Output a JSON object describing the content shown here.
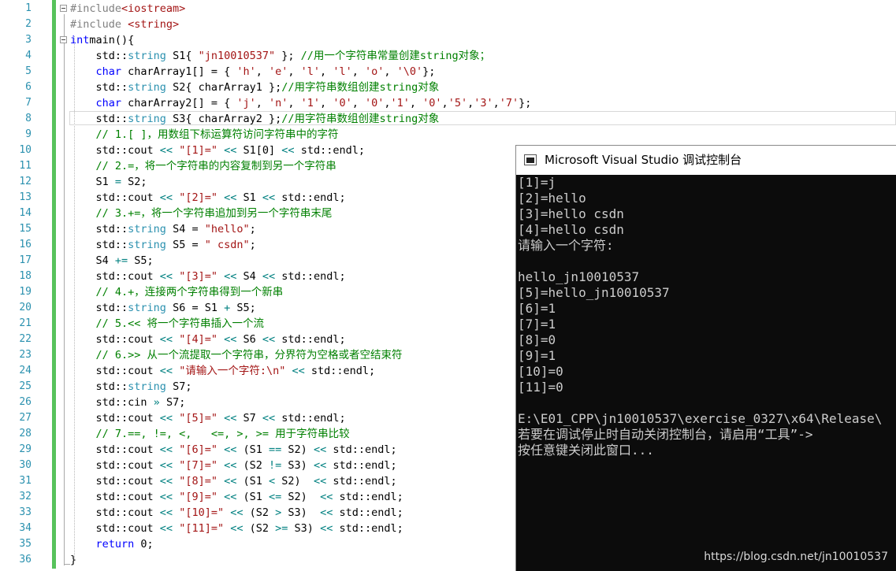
{
  "editor": {
    "line_numbers": [
      "1",
      "2",
      "3",
      "4",
      "5",
      "6",
      "7",
      "8",
      "9",
      "10",
      "11",
      "12",
      "13",
      "14",
      "15",
      "16",
      "17",
      "18",
      "19",
      "20",
      "21",
      "22",
      "23",
      "24",
      "25",
      "26",
      "27",
      "28",
      "29",
      "30",
      "31",
      "32",
      "33",
      "34",
      "35",
      "36"
    ],
    "lines": [
      [
        [
          "pp",
          "#include"
        ],
        [
          "inc",
          "<iostream>"
        ]
      ],
      [
        [
          "pp",
          "#include "
        ],
        [
          "inc",
          "<string>"
        ]
      ],
      [
        [
          "kw",
          "int"
        ],
        [
          "",
          "main(){"
        ]
      ],
      [
        [
          "",
          "    std::"
        ],
        [
          "ty",
          "string"
        ],
        [
          "",
          " S1{ "
        ],
        [
          "st",
          "\"jn10010537\""
        ],
        [
          "",
          " }; "
        ],
        [
          "cm",
          "//用一个字符串常量创建string对象；"
        ]
      ],
      [
        [
          "",
          "    "
        ],
        [
          "kw",
          "char"
        ],
        [
          "",
          " charArray1[] = { "
        ],
        [
          "st",
          "'h'"
        ],
        [
          "",
          ", "
        ],
        [
          "st",
          "'e'"
        ],
        [
          "",
          ", "
        ],
        [
          "st",
          "'l'"
        ],
        [
          "",
          ", "
        ],
        [
          "st",
          "'l'"
        ],
        [
          "",
          ", "
        ],
        [
          "st",
          "'o'"
        ],
        [
          "",
          ", "
        ],
        [
          "st",
          "'\\0'"
        ],
        [
          "",
          "};"
        ]
      ],
      [
        [
          "",
          "    std::"
        ],
        [
          "ty",
          "string"
        ],
        [
          "",
          " S2{ charArray1 };"
        ],
        [
          "cm",
          "//用字符串数组创建string对象"
        ]
      ],
      [
        [
          "",
          "    "
        ],
        [
          "kw",
          "char"
        ],
        [
          "",
          " charArray2[] = { "
        ],
        [
          "st",
          "'j'"
        ],
        [
          "",
          ", "
        ],
        [
          "st",
          "'n'"
        ],
        [
          "",
          ", "
        ],
        [
          "st",
          "'1'"
        ],
        [
          "",
          ", "
        ],
        [
          "st",
          "'0'"
        ],
        [
          "",
          ", "
        ],
        [
          "st",
          "'0'"
        ],
        [
          "",
          ","
        ],
        [
          "st",
          "'1'"
        ],
        [
          "",
          ", "
        ],
        [
          "st",
          "'0'"
        ],
        [
          "",
          ","
        ],
        [
          "st",
          "'5'"
        ],
        [
          "",
          ","
        ],
        [
          "st",
          "'3'"
        ],
        [
          "",
          ","
        ],
        [
          "st",
          "'7'"
        ],
        [
          "",
          "};"
        ]
      ],
      [
        [
          "",
          "    std::"
        ],
        [
          "ty",
          "string"
        ],
        [
          "",
          " S3{ charArray2 };"
        ],
        [
          "cm",
          "//用字符串数组创建string对象"
        ]
      ],
      [
        [
          "",
          "    "
        ],
        [
          "cm",
          "// 1.[ ]，用数组下标运算符访问字符串中的字符"
        ]
      ],
      [
        [
          "",
          "    std::cout "
        ],
        [
          "op",
          "<<"
        ],
        [
          "",
          " "
        ],
        [
          "st",
          "\"[1]=\""
        ],
        [
          "",
          " "
        ],
        [
          "op",
          "<<"
        ],
        [
          "",
          " S1[0] "
        ],
        [
          "op",
          "<<"
        ],
        [
          "",
          " std::endl;"
        ]
      ],
      [
        [
          "",
          "    "
        ],
        [
          "cm",
          "// 2.=，将一个字符串的内容复制到另一个字符串"
        ]
      ],
      [
        [
          "",
          "    S1 "
        ],
        [
          "op",
          "="
        ],
        [
          "",
          " S2;"
        ]
      ],
      [
        [
          "",
          "    std::cout "
        ],
        [
          "op",
          "<<"
        ],
        [
          "",
          " "
        ],
        [
          "st",
          "\"[2]=\""
        ],
        [
          "",
          " "
        ],
        [
          "op",
          "<<"
        ],
        [
          "",
          " S1 "
        ],
        [
          "op",
          "<<"
        ],
        [
          "",
          " std::endl;"
        ]
      ],
      [
        [
          "",
          "    "
        ],
        [
          "cm",
          "// 3.+=，将一个字符串追加到另一个字符串末尾"
        ]
      ],
      [
        [
          "",
          "    std::"
        ],
        [
          "ty",
          "string"
        ],
        [
          "",
          " S4 = "
        ],
        [
          "st",
          "\"hello\""
        ],
        [
          "",
          ";"
        ]
      ],
      [
        [
          "",
          "    std::"
        ],
        [
          "ty",
          "string"
        ],
        [
          "",
          " S5 = "
        ],
        [
          "st",
          "\" csdn\""
        ],
        [
          "",
          ";"
        ]
      ],
      [
        [
          "",
          "    S4 "
        ],
        [
          "op",
          "+="
        ],
        [
          "",
          " S5;"
        ]
      ],
      [
        [
          "",
          "    std::cout "
        ],
        [
          "op",
          "<<"
        ],
        [
          "",
          " "
        ],
        [
          "st",
          "\"[3]=\""
        ],
        [
          "",
          " "
        ],
        [
          "op",
          "<<"
        ],
        [
          "",
          " S4 "
        ],
        [
          "op",
          "<<"
        ],
        [
          "",
          " std::endl;"
        ]
      ],
      [
        [
          "",
          "    "
        ],
        [
          "cm",
          "// 4.+，连接两个字符串得到一个新串"
        ]
      ],
      [
        [
          "",
          "    std::"
        ],
        [
          "ty",
          "string"
        ],
        [
          "",
          " S6 = S1 "
        ],
        [
          "op",
          "+"
        ],
        [
          "",
          " S5;"
        ]
      ],
      [
        [
          "",
          "    "
        ],
        [
          "cm",
          "// 5.<< 将一个字符串插入一个流"
        ]
      ],
      [
        [
          "",
          "    std::cout "
        ],
        [
          "op",
          "<<"
        ],
        [
          "",
          " "
        ],
        [
          "st",
          "\"[4]=\""
        ],
        [
          "",
          " "
        ],
        [
          "op",
          "<<"
        ],
        [
          "",
          " S6 "
        ],
        [
          "op",
          "<<"
        ],
        [
          "",
          " std::endl;"
        ]
      ],
      [
        [
          "",
          "    "
        ],
        [
          "cm",
          "// 6.>> 从一个流提取一个字符串，分界符为空格或者空结束符"
        ]
      ],
      [
        [
          "",
          "    std::cout "
        ],
        [
          "op",
          "<<"
        ],
        [
          "",
          " "
        ],
        [
          "st",
          "\"请输入一个字符:\\n\""
        ],
        [
          "",
          " "
        ],
        [
          "op",
          "<<"
        ],
        [
          "",
          " std::endl;"
        ]
      ],
      [
        [
          "",
          "    std::"
        ],
        [
          "ty",
          "string"
        ],
        [
          "",
          " S7;"
        ]
      ],
      [
        [
          "",
          "    std::cin "
        ],
        [
          "op",
          "»"
        ],
        [
          "",
          " S7;"
        ]
      ],
      [
        [
          "",
          "    std::cout "
        ],
        [
          "op",
          "<<"
        ],
        [
          "",
          " "
        ],
        [
          "st",
          "\"[5]=\""
        ],
        [
          "",
          " "
        ],
        [
          "op",
          "<<"
        ],
        [
          "",
          " S7 "
        ],
        [
          "op",
          "<<"
        ],
        [
          "",
          " std::endl;"
        ]
      ],
      [
        [
          "",
          "    "
        ],
        [
          "cm",
          "// 7.==, !=, <,   <=, >, >= 用于字符串比较"
        ]
      ],
      [
        [
          "",
          "    std::cout "
        ],
        [
          "op",
          "<<"
        ],
        [
          "",
          " "
        ],
        [
          "st",
          "\"[6]=\""
        ],
        [
          "",
          " "
        ],
        [
          "op",
          "<<"
        ],
        [
          "",
          " (S1 "
        ],
        [
          "op",
          "=="
        ],
        [
          "",
          " S2) "
        ],
        [
          "op",
          "<<"
        ],
        [
          "",
          " std::endl;"
        ]
      ],
      [
        [
          "",
          "    std::cout "
        ],
        [
          "op",
          "<<"
        ],
        [
          "",
          " "
        ],
        [
          "st",
          "\"[7]=\""
        ],
        [
          "",
          " "
        ],
        [
          "op",
          "<<"
        ],
        [
          "",
          " (S2 "
        ],
        [
          "op",
          "!="
        ],
        [
          "",
          " S3) "
        ],
        [
          "op",
          "<<"
        ],
        [
          "",
          " std::endl;"
        ]
      ],
      [
        [
          "",
          "    std::cout "
        ],
        [
          "op",
          "<<"
        ],
        [
          "",
          " "
        ],
        [
          "st",
          "\"[8]=\""
        ],
        [
          "",
          " "
        ],
        [
          "op",
          "<<"
        ],
        [
          "",
          " (S1 "
        ],
        [
          "op",
          "<"
        ],
        [
          "",
          " S2)  "
        ],
        [
          "op",
          "<<"
        ],
        [
          "",
          " std::endl;"
        ]
      ],
      [
        [
          "",
          "    std::cout "
        ],
        [
          "op",
          "<<"
        ],
        [
          "",
          " "
        ],
        [
          "st",
          "\"[9]=\""
        ],
        [
          "",
          " "
        ],
        [
          "op",
          "<<"
        ],
        [
          "",
          " (S1 "
        ],
        [
          "op",
          "<="
        ],
        [
          "",
          " S2)  "
        ],
        [
          "op",
          "<<"
        ],
        [
          "",
          " std::endl;"
        ]
      ],
      [
        [
          "",
          "    std::cout "
        ],
        [
          "op",
          "<<"
        ],
        [
          "",
          " "
        ],
        [
          "st",
          "\"[10]=\""
        ],
        [
          "",
          " "
        ],
        [
          "op",
          "<<"
        ],
        [
          "",
          " (S2 "
        ],
        [
          "op",
          ">"
        ],
        [
          "",
          " S3)  "
        ],
        [
          "op",
          "<<"
        ],
        [
          "",
          " std::endl;"
        ]
      ],
      [
        [
          "",
          "    std::cout "
        ],
        [
          "op",
          "<<"
        ],
        [
          "",
          " "
        ],
        [
          "st",
          "\"[11]=\""
        ],
        [
          "",
          " "
        ],
        [
          "op",
          "<<"
        ],
        [
          "",
          " (S2 "
        ],
        [
          "op",
          ">="
        ],
        [
          "",
          " S3) "
        ],
        [
          "op",
          "<<"
        ],
        [
          "",
          " std::endl;"
        ]
      ],
      [
        [
          "",
          "    "
        ],
        [
          "kw",
          "return"
        ],
        [
          "",
          " 0;"
        ]
      ],
      [
        [
          "",
          "}"
        ]
      ]
    ]
  },
  "console": {
    "title": "Microsoft Visual Studio 调试控制台",
    "lines": [
      "[1]=j",
      "[2]=hello",
      "[3]=hello csdn",
      "[4]=hello csdn",
      "请输入一个字符:",
      "",
      "hello_jn10010537",
      "[5]=hello_jn10010537",
      "[6]=1",
      "[7]=1",
      "[8]=0",
      "[9]=1",
      "[10]=0",
      "[11]=0",
      "",
      "E:\\E01_CPP\\jn10010537\\exercise_0327\\x64\\Release\\",
      "若要在调试停止时自动关闭控制台，请启用“工具”->",
      "按任意键关闭此窗口..."
    ]
  },
  "watermark": "https://blog.csdn.net/jn10010537",
  "colors": {
    "keyword": "#0000ff",
    "type": "#2b91af",
    "string": "#a31515",
    "comment": "#008000",
    "preprocessor": "#808080",
    "operator": "#008080",
    "line_number": "#2b91af",
    "change_bar": "#57c25b",
    "console_bg": "#0c0c0c",
    "console_text": "#cccccc"
  }
}
